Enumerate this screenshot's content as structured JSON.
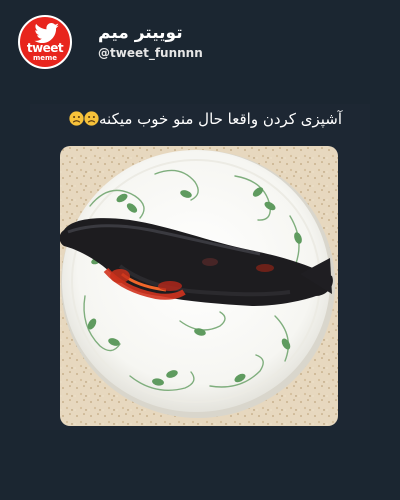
{
  "profile": {
    "display_name": "توییتر میم",
    "handle": "@tweet_funnnn",
    "avatar_logo_line1": "tweet",
    "avatar_logo_line2": "meme"
  },
  "tweet": {
    "text": "آشپزی کردن واقعا حال منو خوب میکنه",
    "emojis": [
      "confused-face",
      "confused-face"
    ],
    "photo": {
      "subject": "burnt-fish-on-plate"
    }
  },
  "colors": {
    "background": "#1b2631",
    "avatar_red": "#e8251d",
    "text": "#ffffff"
  }
}
